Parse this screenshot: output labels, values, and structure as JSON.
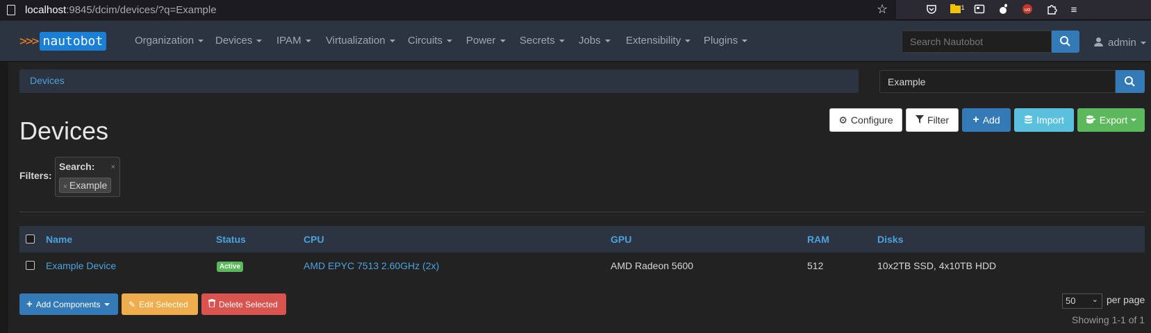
{
  "browser": {
    "url_host": "localhost",
    "url_rest": ":9845/dcim/devices/?q=Example",
    "notification_count": "1"
  },
  "navbar": {
    "brand_chevrons": ">>>",
    "brand_name": "nautobot",
    "items": [
      "Organization",
      "Devices",
      "IPAM",
      "Virtualization",
      "Circuits",
      "Power",
      "Secrets",
      "Jobs",
      "Extensibility",
      "Plugins"
    ],
    "search_placeholder": "Search Nautobot",
    "user": "admin"
  },
  "breadcrumb": {
    "label": "Devices"
  },
  "search": {
    "value": "Example"
  },
  "actions": {
    "configure": "Configure",
    "filter": "Filter",
    "add": "Add",
    "import": "Import",
    "export": "Export"
  },
  "page_title": "Devices",
  "filters": {
    "label": "Filters:",
    "group_title": "Search:",
    "chip": "Example"
  },
  "table": {
    "headers": [
      "Name",
      "Status",
      "CPU",
      "GPU",
      "RAM",
      "Disks"
    ],
    "rows": [
      {
        "name": "Example Device",
        "status": "Active",
        "cpu": "AMD EPYC 7513 2.60GHz (2x)",
        "gpu": "AMD Radeon 5600",
        "ram": "512",
        "disks": "10x2TB SSD, 4x10TB HDD"
      }
    ]
  },
  "bulk": {
    "add_components": "Add Components",
    "edit_selected": "Edit Selected",
    "delete_selected": "Delete Selected"
  },
  "pagination": {
    "per_page_value": "50",
    "per_page_label": "per page",
    "showing": "Showing 1-1 of 1"
  },
  "colors": {
    "navbar_bg": "#2c3441",
    "primary": "#337ab7",
    "info": "#5bc0de",
    "success": "#5cb85c",
    "warning": "#f0ad4e",
    "danger": "#d9534f",
    "link": "#4aa3df"
  }
}
